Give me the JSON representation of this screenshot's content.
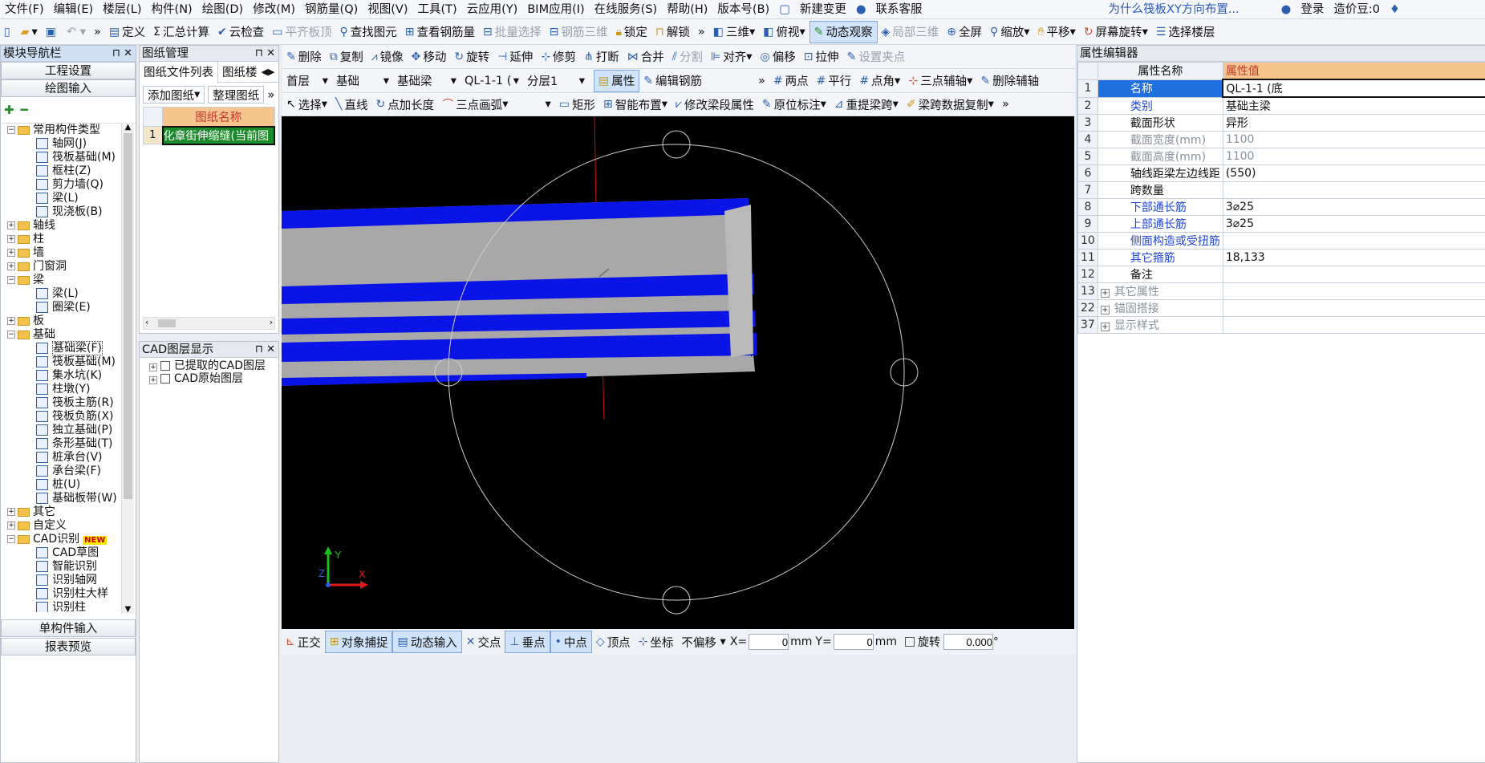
{
  "menu": [
    "文件(F)",
    "编辑(E)",
    "楼层(L)",
    "构件(N)",
    "绘图(D)",
    "修改(M)",
    "钢筋量(Q)",
    "视图(V)",
    "工具(T)",
    "云应用(Y)",
    "BIM应用(I)",
    "在线服务(S)",
    "帮助(H)",
    "版本号(B)"
  ],
  "menu_right": {
    "new_change": "新建变更",
    "support": "联系客服",
    "question": "为什么筏板XY方向布置...",
    "login": "登录",
    "price": "造价豆:0"
  },
  "toolbar1": [
    "定义",
    "汇总计算",
    "云检查",
    "平齐板顶",
    "查找图元",
    "查看钢筋量",
    "批量选择",
    "钢筋三维",
    "锁定",
    "解锁",
    "三维",
    "俯视",
    "动态观察",
    "局部三维",
    "全屏",
    "缩放",
    "平移",
    "屏幕旋转",
    "选择楼层"
  ],
  "nav": {
    "title": "模块导航栏",
    "engineering": "工程设置",
    "drawing": "绘图输入",
    "single": "单构件输入",
    "report": "报表预览"
  },
  "tree": [
    {
      "l": 0,
      "t": "常用构件类型",
      "f": true,
      "e": "−"
    },
    {
      "l": 1,
      "t": "轴网(J)"
    },
    {
      "l": 1,
      "t": "筏板基础(M)"
    },
    {
      "l": 1,
      "t": "框柱(Z)"
    },
    {
      "l": 1,
      "t": "剪力墙(Q)"
    },
    {
      "l": 1,
      "t": "梁(L)"
    },
    {
      "l": 1,
      "t": "现浇板(B)"
    },
    {
      "l": 0,
      "t": "轴线",
      "f": true,
      "e": "+"
    },
    {
      "l": 0,
      "t": "柱",
      "f": true,
      "e": "+"
    },
    {
      "l": 0,
      "t": "墙",
      "f": true,
      "e": "+"
    },
    {
      "l": 0,
      "t": "门窗洞",
      "f": true,
      "e": "+"
    },
    {
      "l": 0,
      "t": "梁",
      "f": true,
      "e": "−"
    },
    {
      "l": 1,
      "t": "梁(L)"
    },
    {
      "l": 1,
      "t": "圈梁(E)"
    },
    {
      "l": 0,
      "t": "板",
      "f": true,
      "e": "+"
    },
    {
      "l": 0,
      "t": "基础",
      "f": true,
      "e": "−"
    },
    {
      "l": 1,
      "t": "基础梁(F)",
      "s": true
    },
    {
      "l": 1,
      "t": "筏板基础(M)"
    },
    {
      "l": 1,
      "t": "集水坑(K)"
    },
    {
      "l": 1,
      "t": "柱墩(Y)"
    },
    {
      "l": 1,
      "t": "筏板主筋(R)"
    },
    {
      "l": 1,
      "t": "筏板负筋(X)"
    },
    {
      "l": 1,
      "t": "独立基础(P)"
    },
    {
      "l": 1,
      "t": "条形基础(T)"
    },
    {
      "l": 1,
      "t": "桩承台(V)"
    },
    {
      "l": 1,
      "t": "承台梁(F)"
    },
    {
      "l": 1,
      "t": "桩(U)"
    },
    {
      "l": 1,
      "t": "基础板带(W)"
    },
    {
      "l": 0,
      "t": "其它",
      "f": true,
      "e": "+"
    },
    {
      "l": 0,
      "t": "自定义",
      "f": true,
      "e": "+"
    },
    {
      "l": 0,
      "t": "CAD识别",
      "f": true,
      "e": "−",
      "new": "NEW"
    },
    {
      "l": 1,
      "t": "CAD草图"
    },
    {
      "l": 1,
      "t": "智能识别"
    },
    {
      "l": 1,
      "t": "识别轴网"
    },
    {
      "l": 1,
      "t": "识别柱大样"
    },
    {
      "l": 1,
      "t": "识别柱"
    }
  ],
  "drawings": {
    "title": "图纸管理",
    "tab1": "图纸文件列表",
    "tab2": "图纸楼",
    "add": "添加图纸",
    "tidy": "整理图纸",
    "col": "图纸名称",
    "row_num": "1",
    "row_name": "化章街伸缩缝(当前图"
  },
  "cad_layers": {
    "title": "CAD图层显示",
    "items": [
      "已提取的CAD图层",
      "CAD原始图层"
    ]
  },
  "edit_tb": [
    "删除",
    "复制",
    "镜像",
    "移动",
    "旋转",
    "延伸",
    "修剪",
    "打断",
    "合并",
    "分割",
    "对齐",
    "偏移",
    "拉伸",
    "设置夹点"
  ],
  "selectors": {
    "floor": "首层",
    "type": "基础",
    "sub": "基础梁",
    "name": "QL-1-1 (",
    "layer": "分层1",
    "prop": "属性",
    "rebar": "编辑钢筋",
    "axis": [
      "两点",
      "平行",
      "点角",
      "三点辅轴",
      "删除辅轴"
    ]
  },
  "draw_tb": [
    "选择",
    "直线",
    "点加长度",
    "三点画弧",
    "矩形",
    "智能布置",
    "修改梁段属性",
    "原位标注",
    "重提梁跨",
    "梁跨数据复制"
  ],
  "properties": {
    "title": "属性编辑器",
    "h1": "属性名称",
    "h2": "属性值",
    "rows": [
      {
        "n": "1",
        "k": "名称",
        "v": "QL-1-1 (底",
        "c": "blue",
        "sel": true
      },
      {
        "n": "2",
        "k": "类别",
        "v": "基础主梁",
        "c": "blue"
      },
      {
        "n": "3",
        "k": "截面形状",
        "v": "异形"
      },
      {
        "n": "4",
        "k": "截面宽度(mm)",
        "v": "1100",
        "c": "gray"
      },
      {
        "n": "5",
        "k": "截面高度(mm)",
        "v": "1100",
        "c": "gray"
      },
      {
        "n": "6",
        "k": "轴线距梁左边线距",
        "v": "(550)"
      },
      {
        "n": "7",
        "k": "跨数量",
        "v": ""
      },
      {
        "n": "8",
        "k": "下部通长筋",
        "v": "3⌀25",
        "c": "blue"
      },
      {
        "n": "9",
        "k": "上部通长筋",
        "v": "3⌀25",
        "c": "blue"
      },
      {
        "n": "10",
        "k": "侧面构造或受扭筋",
        "v": "",
        "c": "blue"
      },
      {
        "n": "11",
        "k": "其它箍筋",
        "v": "18,133",
        "c": "blue"
      },
      {
        "n": "12",
        "k": "备注",
        "v": ""
      },
      {
        "n": "13",
        "k": "其它属性",
        "v": "",
        "c": "gray",
        "x": true
      },
      {
        "n": "22",
        "k": "锚固搭接",
        "v": "",
        "c": "gray",
        "x": true
      },
      {
        "n": "37",
        "k": "显示样式",
        "v": "",
        "c": "gray",
        "x": true
      }
    ]
  },
  "status": {
    "items": [
      "正交",
      "对象捕捉",
      "动态输入",
      "交点",
      "垂点",
      "中点",
      "顶点",
      "坐标"
    ],
    "offset": "不偏移",
    "x_label": "X=",
    "x": "0",
    "mm1": "mm",
    "y_label": "Y=",
    "y": "0",
    "mm2": "mm",
    "rot": "旋转",
    "rot_val": "0.000"
  },
  "axes": {
    "x": "X",
    "y": "Y",
    "z": "Z"
  }
}
